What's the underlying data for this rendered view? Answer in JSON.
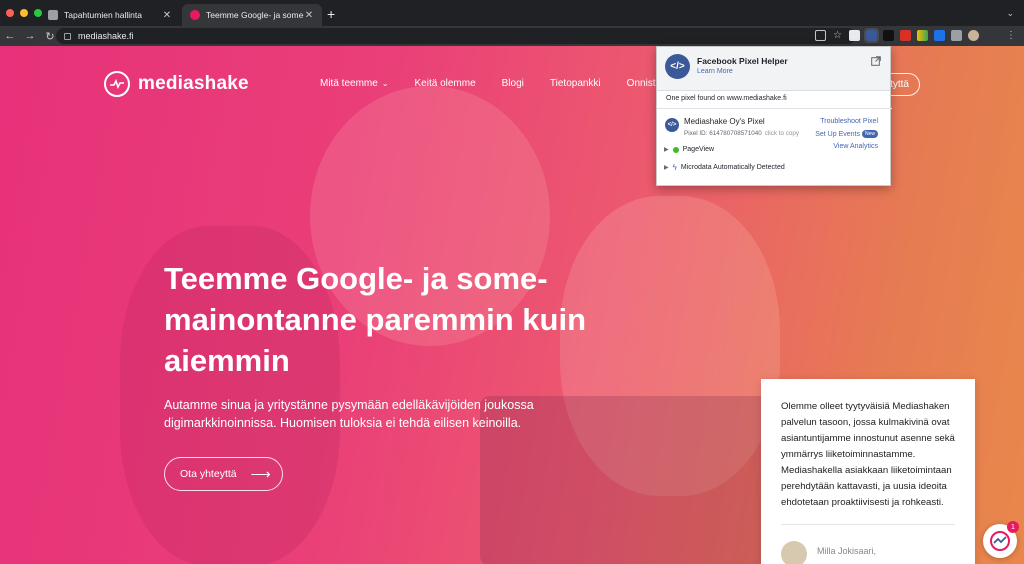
{
  "browser": {
    "tabs": [
      {
        "title": "Tapahtumien hallinta",
        "active": false,
        "favicon_color": "#9aa0a6"
      },
      {
        "title": "Teemme Google- ja some-mainontanne",
        "active": true,
        "favicon_color": "#e8195d"
      }
    ],
    "new_tab": "+",
    "tab_menu": "⌄",
    "nav": {
      "back": "←",
      "forward": "→",
      "reload": "↻"
    },
    "url": "mediashake.fi",
    "menu": "⋮"
  },
  "site": {
    "logo_text": "mediashake",
    "nav": [
      "Mitä teemme",
      "Keitä olemme",
      "Blogi",
      "Tietopankki",
      "Onnistum"
    ],
    "nav_caret": "⌄",
    "top_cta": "tyttä",
    "hero_title": "Teemme Google- ja some-mainontanne paremmin kuin aiemmin",
    "hero_lead": "Autamme sinua ja yritystänne pysymään edelläkävijöiden joukossa digimarkkinoinnissa. Huomisen tuloksia ei tehdä eilisen keinoilla.",
    "cta_label": "Ota yhteyttä",
    "cta_arrow": "⟶",
    "testimonial": {
      "quote": "Olemme olleet tyytyväisiä Mediashaken palvelun tasoon, jossa kulmakivinä ovat asiantuntijamme innostunut asenne sekä ymmärrys liiketoiminnastamme. Mediashakella asiakkaan liiketoimintaan perehdytään kattavasti, ja uusia ideoita ehdotetaan proaktiivisesti ja rohkeasti.",
      "author": "Milla Jokisaari,"
    },
    "chat_badge": "1"
  },
  "pixel_helper": {
    "title": "Facebook Pixel Helper",
    "learn_more": "Learn More",
    "found_text": "One pixel found on www.mediashake.fi",
    "pixel_name": "Mediashake Oy's Pixel",
    "pixel_id": "Pixel ID: 614780708571040",
    "copy_hint": "click to copy",
    "links": [
      "Troubleshoot Pixel",
      "Set Up Events",
      "View Analytics"
    ],
    "new_badge": "New",
    "events": [
      "PageView",
      "Microdata Automatically Detected"
    ],
    "icon_glyph": "</>"
  },
  "colors": {
    "brand": "#e8195d",
    "facebook": "#3b5998",
    "link": "#4267b2"
  }
}
